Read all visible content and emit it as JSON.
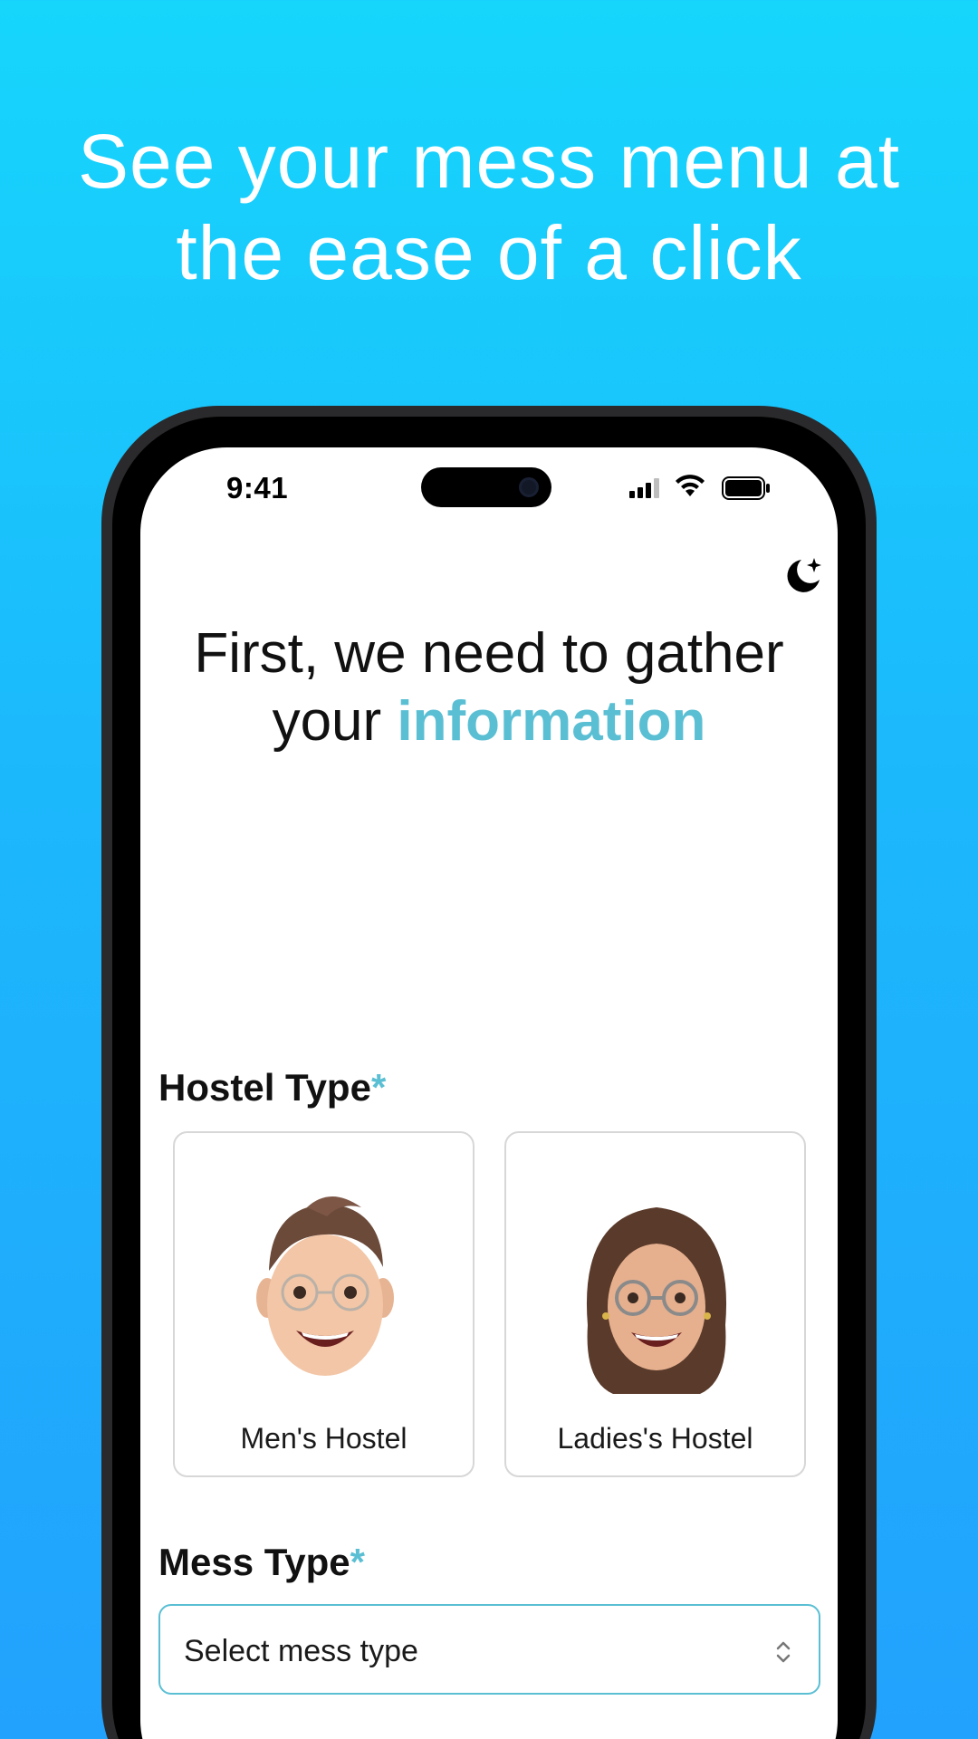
{
  "headline": {
    "line1": "See your mess menu at",
    "line2": "the ease of a click"
  },
  "status_bar": {
    "time": "9:41",
    "icons": [
      "signal-icon",
      "wifi-icon",
      "battery-icon"
    ]
  },
  "theme_toggle_icon": "moon-stars-icon",
  "title": {
    "prefix": "First, we need to gather your ",
    "accent": "information"
  },
  "hostel_type": {
    "label": "Hostel Type",
    "required_mark": "*",
    "options": [
      {
        "label": "Men's Hostel",
        "icon": "male-avatar-icon"
      },
      {
        "label": "Ladies's Hostel",
        "icon": "female-avatar-icon"
      }
    ]
  },
  "mess_type": {
    "label": "Mess Type",
    "required_mark": "*",
    "placeholder": "Select mess type"
  },
  "colors": {
    "background_top": "#16d6fc",
    "background_bottom": "#22a2fd",
    "accent": "#5bbfd4"
  }
}
